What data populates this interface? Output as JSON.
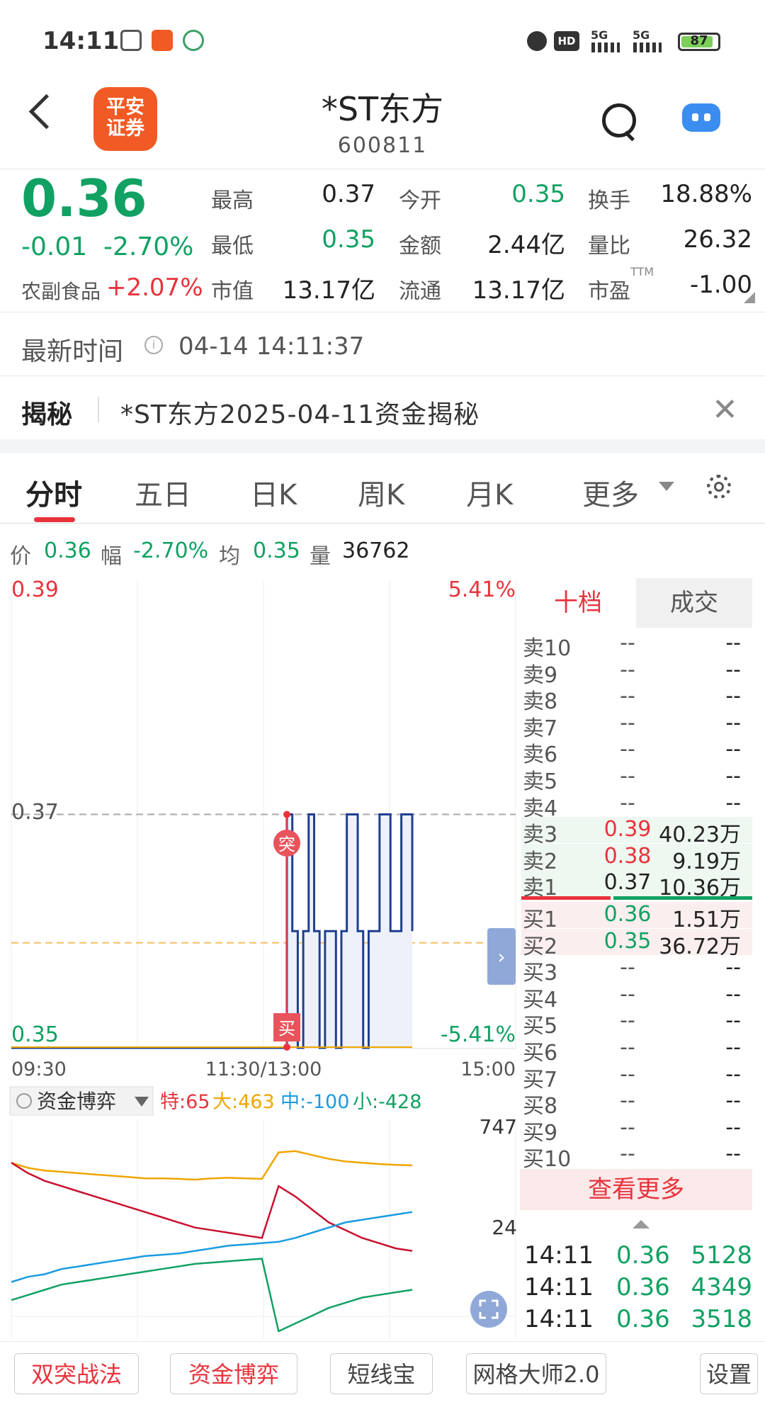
{
  "status_bar": {
    "time": "14:11",
    "icons": [
      "app-notification-icon",
      "pingan-app-icon",
      "leaf-app-icon",
      "alarm-icon",
      "hd-icon",
      "5g-signal-icon",
      "5g-signal-icon"
    ],
    "hd": "HD",
    "net1": "5G",
    "net2": "5G",
    "battery": "87",
    "battery_level": 87
  },
  "header": {
    "logo_line1": "平安",
    "logo_line2": "证券",
    "title": "*ST东方",
    "code": "600811"
  },
  "quote": {
    "price": "0.36",
    "change": "-0.01",
    "change_pct": "-2.70%",
    "sector": "农副食品",
    "sector_pct": "+2.07%",
    "fields": [
      {
        "label": "最高",
        "value": "0.37",
        "color": "#222222"
      },
      {
        "label": "今开",
        "value": "0.35",
        "color": "#11a163"
      },
      {
        "label": "换手",
        "value": "18.88%",
        "color": "#222222"
      },
      {
        "label": "最低",
        "value": "0.35",
        "color": "#11a163"
      },
      {
        "label": "金额",
        "value": "2.44亿",
        "color": "#222222"
      },
      {
        "label": "量比",
        "value": "26.32",
        "color": "#222222"
      },
      {
        "label": "市值",
        "value": "13.17亿",
        "color": "#222222"
      },
      {
        "label": "流通",
        "value": "13.17亿",
        "color": "#222222"
      },
      {
        "label": "市盈",
        "value": "-1.00",
        "color": "#222222"
      }
    ],
    "pe_tag": "TTM"
  },
  "latest": {
    "label": "最新时间",
    "value": "04-14 14:11:37"
  },
  "reveal": {
    "label": "揭秘",
    "text": "*ST东方2025-04-11资金揭秘"
  },
  "tabs": [
    "分时",
    "五日",
    "日K",
    "周K",
    "月K",
    "更多"
  ],
  "info_line": {
    "price_label": "价",
    "price": "0.36",
    "range_label": "幅",
    "range": "-2.70%",
    "avg_label": "均",
    "avg": "0.35",
    "vol_label": "量",
    "vol": "36762"
  },
  "chart_data": [
    {
      "type": "line",
      "title": "",
      "y_left_ticks": [
        "0.39",
        "0.37",
        "0.35"
      ],
      "y_right_ticks": [
        "5.41%",
        "-5.41%"
      ],
      "x_ticks": [
        "09:30",
        "11:30/13:00",
        "15:00"
      ],
      "ylim": [
        0.35,
        0.39
      ],
      "prev_close": 0.37,
      "avg_line": 0.35,
      "series": [
        {
          "values": [
            0.35,
            0.35,
            0.35,
            0.35,
            0.35,
            0.35,
            0.35,
            0.35,
            0.35,
            0.35,
            0.35,
            0.37,
            0.36,
            0.35,
            0.36,
            0.37,
            0.36,
            0.35,
            0.36,
            0.36,
            0.35,
            0.36,
            0.37,
            0.37,
            0.36,
            0.35,
            0.36,
            0.36,
            0.37,
            0.37,
            0.36,
            0.36,
            0.37,
            0.37,
            0.36
          ]
        }
      ],
      "markers": [
        {
          "text": "突",
          "color": "#e8333c"
        },
        {
          "text": "买",
          "color": "#e8333c"
        }
      ]
    },
    {
      "type": "line",
      "title": "资金博弈",
      "legend": [
        {
          "label": "特:65",
          "color": "#e8333c"
        },
        {
          "label": "大:463",
          "color": "#f0a500"
        },
        {
          "label": "中:-100",
          "color": "#1a9be0"
        },
        {
          "label": "小:-428",
          "color": "#11a163"
        }
      ],
      "y_ticks": [
        "747",
        "24"
      ],
      "series": [
        {
          "name": "大",
          "values": [
            560,
            540,
            530,
            525,
            520,
            515,
            510,
            505,
            500,
            500,
            498,
            495,
            500,
            502,
            500,
            498,
            600,
            605,
            590,
            575,
            565,
            560,
            555,
            552,
            550
          ]
        },
        {
          "name": "特",
          "values": [
            560,
            520,
            490,
            470,
            450,
            430,
            410,
            390,
            370,
            350,
            330,
            310,
            300,
            290,
            280,
            270,
            470,
            430,
            380,
            330,
            300,
            270,
            250,
            230,
            220
          ]
        },
        {
          "name": "中",
          "values": [
            100,
            120,
            130,
            150,
            160,
            170,
            180,
            190,
            200,
            205,
            210,
            220,
            230,
            240,
            245,
            250,
            255,
            270,
            290,
            310,
            330,
            340,
            350,
            360,
            370
          ]
        },
        {
          "name": "小",
          "values": [
            30,
            50,
            70,
            90,
            100,
            110,
            120,
            130,
            140,
            150,
            160,
            170,
            175,
            180,
            185,
            190,
            -90,
            -60,
            -30,
            0,
            20,
            40,
            50,
            60,
            70
          ]
        }
      ]
    }
  ],
  "order_book": {
    "tab_active": "十档",
    "tab_other": "成交",
    "asks": [
      {
        "label": "卖10",
        "price": "--",
        "vol": "--",
        "pcolor": "#555555",
        "bar": 0
      },
      {
        "label": "卖9",
        "price": "--",
        "vol": "--",
        "pcolor": "#555555",
        "bar": 0
      },
      {
        "label": "卖8",
        "price": "--",
        "vol": "--",
        "pcolor": "#555555",
        "bar": 0
      },
      {
        "label": "卖7",
        "price": "--",
        "vol": "--",
        "pcolor": "#555555",
        "bar": 0
      },
      {
        "label": "卖6",
        "price": "--",
        "vol": "--",
        "pcolor": "#555555",
        "bar": 0
      },
      {
        "label": "卖5",
        "price": "--",
        "vol": "--",
        "pcolor": "#555555",
        "bar": 0
      },
      {
        "label": "卖4",
        "price": "--",
        "vol": "--",
        "pcolor": "#555555",
        "bar": 0
      },
      {
        "label": "卖3",
        "price": "0.39",
        "vol": "40.23万",
        "pcolor": "#e8333c",
        "bar": 1
      },
      {
        "label": "卖2",
        "price": "0.38",
        "vol": "9.19万",
        "pcolor": "#e8333c",
        "bar": 1
      },
      {
        "label": "卖1",
        "price": "0.37",
        "vol": "10.36万",
        "pcolor": "#222222",
        "bar": 1
      }
    ],
    "bids": [
      {
        "label": "买1",
        "price": "0.36",
        "vol": "1.51万",
        "pcolor": "#11a163",
        "bar": 1
      },
      {
        "label": "买2",
        "price": "0.35",
        "vol": "36.72万",
        "pcolor": "#11a163",
        "bar": 1
      },
      {
        "label": "买3",
        "price": "--",
        "vol": "--",
        "pcolor": "#555555",
        "bar": 0
      },
      {
        "label": "买4",
        "price": "--",
        "vol": "--",
        "pcolor": "#555555",
        "bar": 0
      },
      {
        "label": "买5",
        "price": "--",
        "vol": "--",
        "pcolor": "#555555",
        "bar": 0
      },
      {
        "label": "买6",
        "price": "--",
        "vol": "--",
        "pcolor": "#555555",
        "bar": 0
      },
      {
        "label": "买7",
        "price": "--",
        "vol": "--",
        "pcolor": "#555555",
        "bar": 0
      },
      {
        "label": "买8",
        "price": "--",
        "vol": "--",
        "pcolor": "#555555",
        "bar": 0
      },
      {
        "label": "买9",
        "price": "--",
        "vol": "--",
        "pcolor": "#555555",
        "bar": 0
      },
      {
        "label": "买10",
        "price": "--",
        "vol": "--",
        "pcolor": "#555555",
        "bar": 0
      }
    ],
    "more": "查看更多",
    "trades": [
      {
        "time": "14:11",
        "price": "0.36",
        "vol": "5128"
      },
      {
        "time": "14:11",
        "price": "0.36",
        "vol": "4349"
      },
      {
        "time": "14:11",
        "price": "0.36",
        "vol": "3518"
      }
    ]
  },
  "bottom_bar": {
    "buttons": [
      {
        "label": "双突战法",
        "color": "#e8333c"
      },
      {
        "label": "资金博弈",
        "color": "#e8333c"
      },
      {
        "label": "短线宝",
        "color": "#444444"
      },
      {
        "label": "网格大师2.0",
        "color": "#444444"
      },
      {
        "label": "设置",
        "color": "#444444"
      }
    ]
  },
  "colors": {
    "up": "#e8333c",
    "down": "#11a163",
    "price_line": "#1f3f8f",
    "accent": "#f15a24"
  }
}
